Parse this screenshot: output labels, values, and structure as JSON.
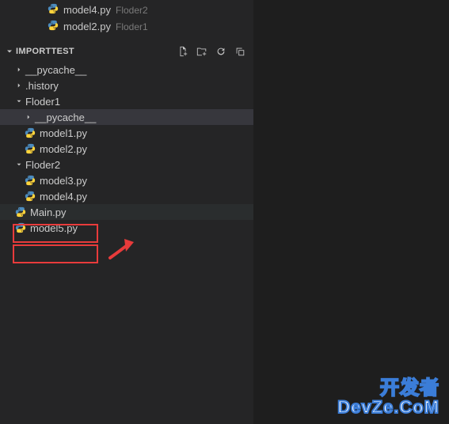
{
  "editorTabs": [
    {
      "name": "model4.py",
      "dir": "Floder2"
    },
    {
      "name": "model2.py",
      "dir": "Floder1"
    }
  ],
  "section": {
    "title": "IMPORTTEST"
  },
  "tree": {
    "pycache": "__pycache__",
    "history": ".history",
    "floder1": "Floder1",
    "floder1_pycache": "__pycache__",
    "model1": "model1.py",
    "model2": "model2.py",
    "floder2": "Floder2",
    "model3": "model3.py",
    "model4": "model4.py",
    "main": "Main.py",
    "model5": "model5.py"
  },
  "watermark": {
    "line1": "开发者",
    "line2": "DevZe.CoM"
  }
}
